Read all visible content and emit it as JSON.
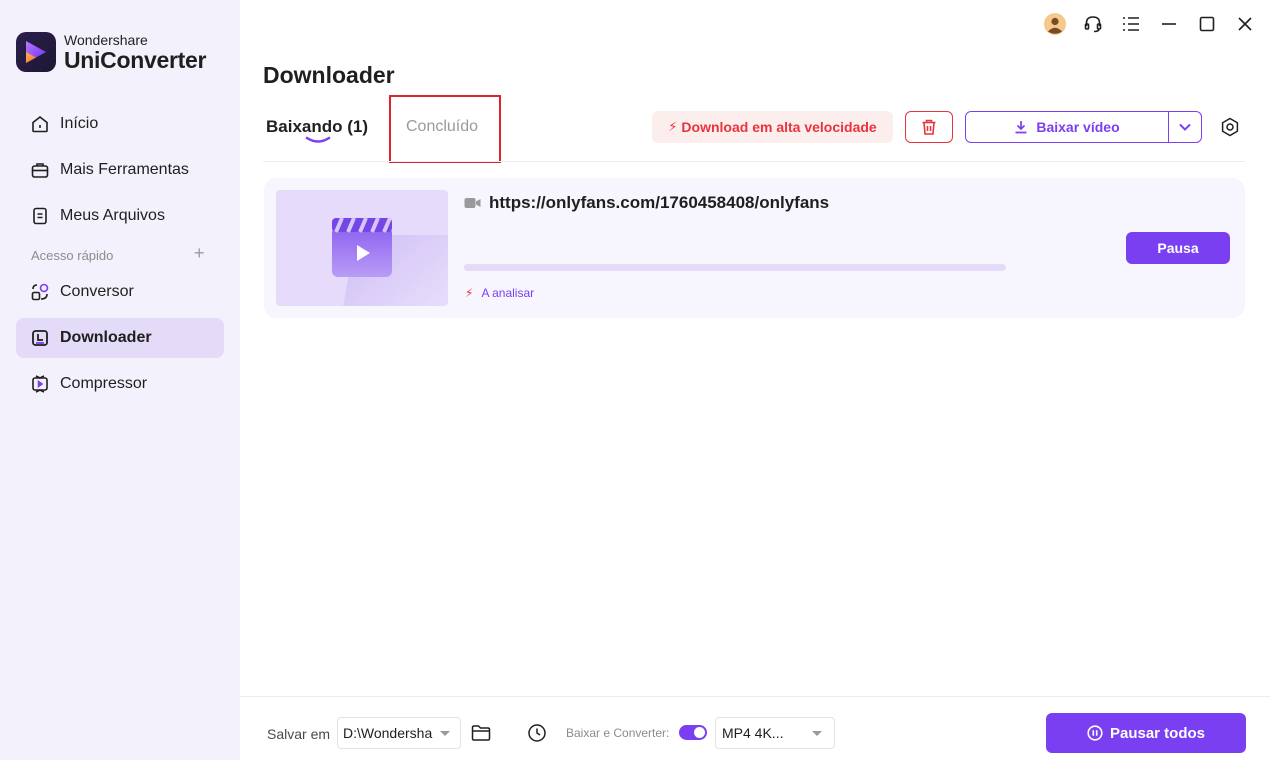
{
  "app": {
    "brand": "Wondershare",
    "product": "UniConverter",
    "logo_icon": "uniconverter-logo-icon"
  },
  "sidebar": {
    "items": [
      {
        "label": "Início",
        "icon": "home-icon"
      },
      {
        "label": "Mais Ferramentas",
        "icon": "toolbox-icon"
      },
      {
        "label": "Meus Arquivos",
        "icon": "file-icon"
      }
    ],
    "quick_access_label": "Acesso rápido",
    "quick_access_add": "+",
    "quick_items": [
      {
        "label": "Conversor",
        "icon": "converter-icon"
      },
      {
        "label": "Downloader",
        "icon": "downloader-icon",
        "active": true
      },
      {
        "label": "Compressor",
        "icon": "compressor-icon"
      }
    ]
  },
  "titlebar": {
    "icons": [
      "avatar-icon",
      "headset-icon",
      "menu-icon",
      "minimize-icon",
      "maximize-icon",
      "close-icon"
    ]
  },
  "main": {
    "title": "Downloader",
    "tabs": [
      {
        "label": "Baixando (1)",
        "active": true
      },
      {
        "label": "Concluído",
        "active": false
      }
    ],
    "toolbar": {
      "high_speed_label": "Download em alta velocidade",
      "download_video_label": "Baixar vídeo"
    },
    "downloads": [
      {
        "url": "https://onlyfans.com/1760458408/onlyfans",
        "progress": 0,
        "status": "A analisar",
        "pause_label": "Pausa"
      }
    ]
  },
  "footer": {
    "save_label": "Salvar em",
    "save_path": "D:\\Wondersha",
    "convert_label": "Baixar e Converter:",
    "convert_enabled": true,
    "format": "MP4 4K...",
    "pause_all_label": "Pausar todos"
  },
  "colors": {
    "accent": "#7b3ff2",
    "danger": "#e8343c",
    "sidebar_bg": "#f3f1fb",
    "active_nav_bg": "#e3dbf7"
  }
}
